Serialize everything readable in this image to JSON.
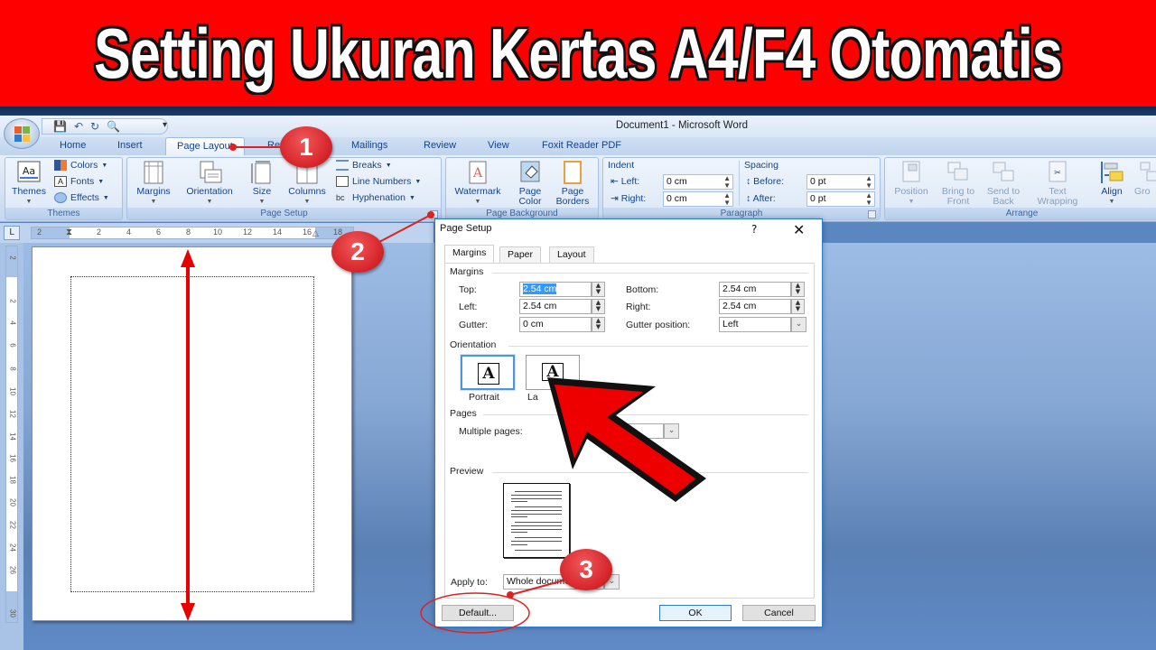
{
  "banner": {
    "title": "Setting Ukuran Kertas A4/F4 Otomatis",
    "color": "#fe0000"
  },
  "window": {
    "title": "Document1 - Microsoft Word"
  },
  "quick_access": {
    "icons": [
      "save-icon",
      "undo-icon",
      "redo-icon",
      "print-preview-icon"
    ],
    "customize": "▾"
  },
  "ribbon_tabs": [
    {
      "label": "Home"
    },
    {
      "label": "Insert"
    },
    {
      "label": "Page Layout",
      "active": true
    },
    {
      "label": "References"
    },
    {
      "label": "Mailings"
    },
    {
      "label": "Review"
    },
    {
      "label": "View"
    },
    {
      "label": "Foxit Reader PDF"
    }
  ],
  "ribbon": {
    "themes": {
      "label": "Themes",
      "themes_button": "Themes",
      "colors": "Colors",
      "fonts": "Fonts",
      "effects": "Effects"
    },
    "page_setup": {
      "label": "Page Setup",
      "margins": "Margins",
      "orientation": "Orientation",
      "size": "Size",
      "columns": "Columns",
      "breaks": "Breaks",
      "line_numbers": "Line Numbers",
      "hyphenation": "Hyphenation"
    },
    "page_background": {
      "label": "Page Background",
      "watermark": "Watermark",
      "page_color_1": "Page",
      "page_color_2": "Color",
      "page_borders_1": "Page",
      "page_borders_2": "Borders"
    },
    "paragraph": {
      "label": "Paragraph",
      "indent": "Indent",
      "left_label": "Left:",
      "left_value": "0 cm",
      "right_label": "Right:",
      "right_value": "0 cm",
      "spacing": "Spacing",
      "before_label": "Before:",
      "before_value": "0 pt",
      "after_label": "After:",
      "after_value": "0 pt"
    },
    "arrange": {
      "label": "Arrange",
      "position": "Position",
      "bring_front_1": "Bring to",
      "bring_front_2": "Front",
      "send_back_1": "Send to",
      "send_back_2": "Back",
      "text_wrap_1": "Text",
      "text_wrap_2": "Wrapping",
      "align": "Align",
      "group": "Gro"
    }
  },
  "ruler": {
    "horizontal_ticks": [
      "2",
      "2",
      "4",
      "6",
      "8",
      "10",
      "12",
      "14",
      "16",
      "18"
    ],
    "vertical_ticks": [
      "2",
      "2",
      "4",
      "6",
      "8",
      "10",
      "12",
      "14",
      "16",
      "18",
      "20",
      "22",
      "24",
      "26",
      "30"
    ],
    "tab_selector": "L"
  },
  "dialog": {
    "title": "Page Setup",
    "help": "?",
    "close": "✕",
    "tabs": [
      {
        "label": "Margins",
        "active": true
      },
      {
        "label": "Paper"
      },
      {
        "label": "Layout"
      }
    ],
    "margins_section": "Margins",
    "fields": {
      "top_label": "Top:",
      "top_value": "2.54 cm",
      "bottom_label": "Bottom:",
      "bottom_value": "2.54 cm",
      "left_label": "Left:",
      "left_value": "2.54 cm",
      "right_label": "Right:",
      "right_value": "2.54 cm",
      "gutter_label": "Gutter:",
      "gutter_value": "0 cm",
      "gutter_pos_label": "Gutter position:",
      "gutter_pos_value": "Left"
    },
    "orientation_section": "Orientation",
    "orientation": {
      "portrait": "Portrait",
      "landscape": "La",
      "glyph": "A",
      "selected": "Portrait"
    },
    "pages_section": "Pages",
    "multiple_pages_label": "Multiple pages:",
    "preview_section": "Preview",
    "apply_to_label": "Apply to:",
    "apply_to_value": "Whole document",
    "buttons": {
      "default": "Default...",
      "ok": "OK",
      "cancel": "Cancel"
    }
  },
  "annotations": {
    "badges": [
      "1",
      "2",
      "3"
    ],
    "accent": "#e01010"
  }
}
